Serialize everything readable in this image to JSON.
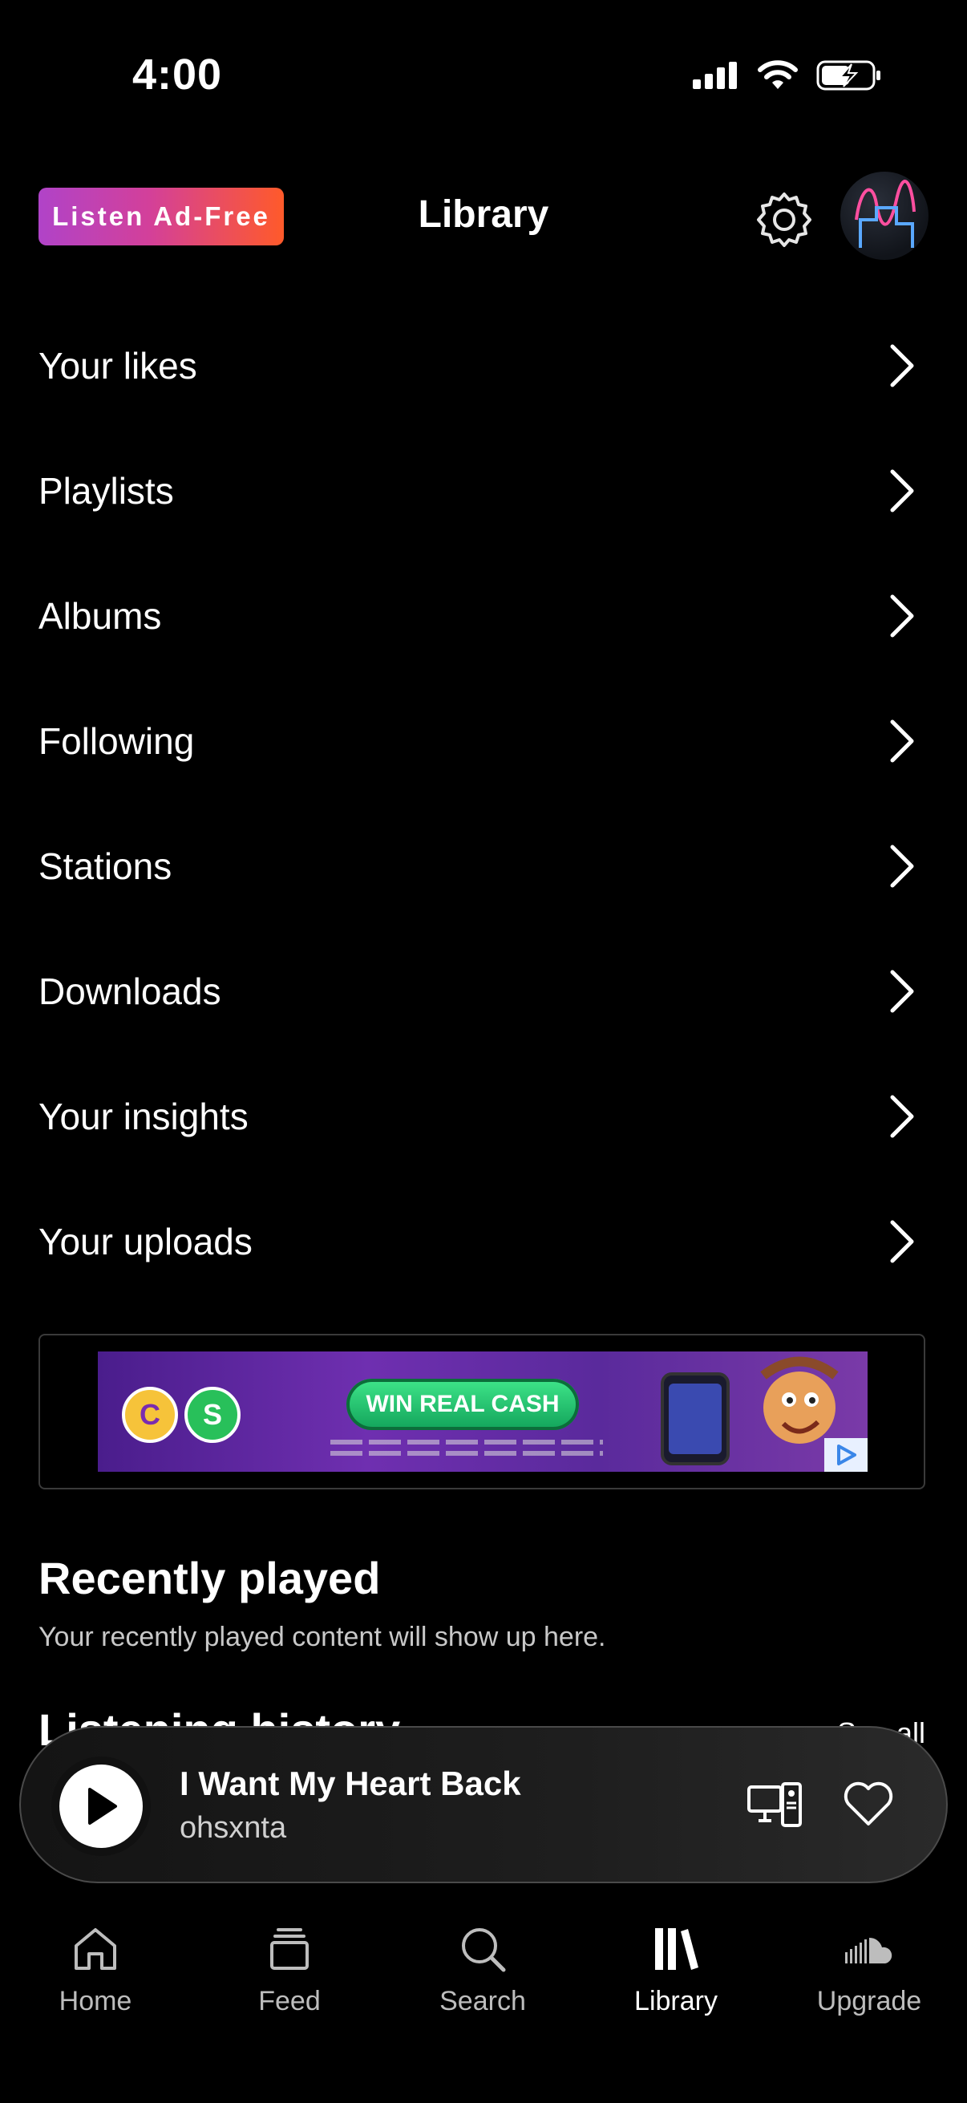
{
  "status_bar": {
    "time": "4:00"
  },
  "header": {
    "ad_free_label": "Listen Ad-Free",
    "title": "Library",
    "settings_icon": "gear-icon",
    "avatar_icon": "avatar"
  },
  "menu": {
    "items": [
      {
        "label": "Your likes"
      },
      {
        "label": "Playlists"
      },
      {
        "label": "Albums"
      },
      {
        "label": "Following"
      },
      {
        "label": "Stations"
      },
      {
        "label": "Downloads"
      },
      {
        "label": "Your insights"
      },
      {
        "label": "Your uploads"
      }
    ]
  },
  "ad": {
    "cta": "WIN REAL CASH",
    "logo_letters": [
      "C",
      "S"
    ]
  },
  "recently_played": {
    "title": "Recently played",
    "subtitle": "Your recently played content will show up here."
  },
  "listening_history": {
    "title": "Listening history",
    "see_all": "See all"
  },
  "player": {
    "title": "I Want My Heart Back",
    "artist": "ohsxnta"
  },
  "tabs": [
    {
      "label": "Home",
      "icon": "home-icon"
    },
    {
      "label": "Feed",
      "icon": "feed-icon"
    },
    {
      "label": "Search",
      "icon": "search-icon"
    },
    {
      "label": "Library",
      "icon": "library-icon",
      "active": true
    },
    {
      "label": "Upgrade",
      "icon": "soundcloud-icon"
    }
  ],
  "colors": {
    "background": "#000000",
    "accent_gradient_start": "#b043c8",
    "accent_gradient_end": "#ff5a2a"
  }
}
